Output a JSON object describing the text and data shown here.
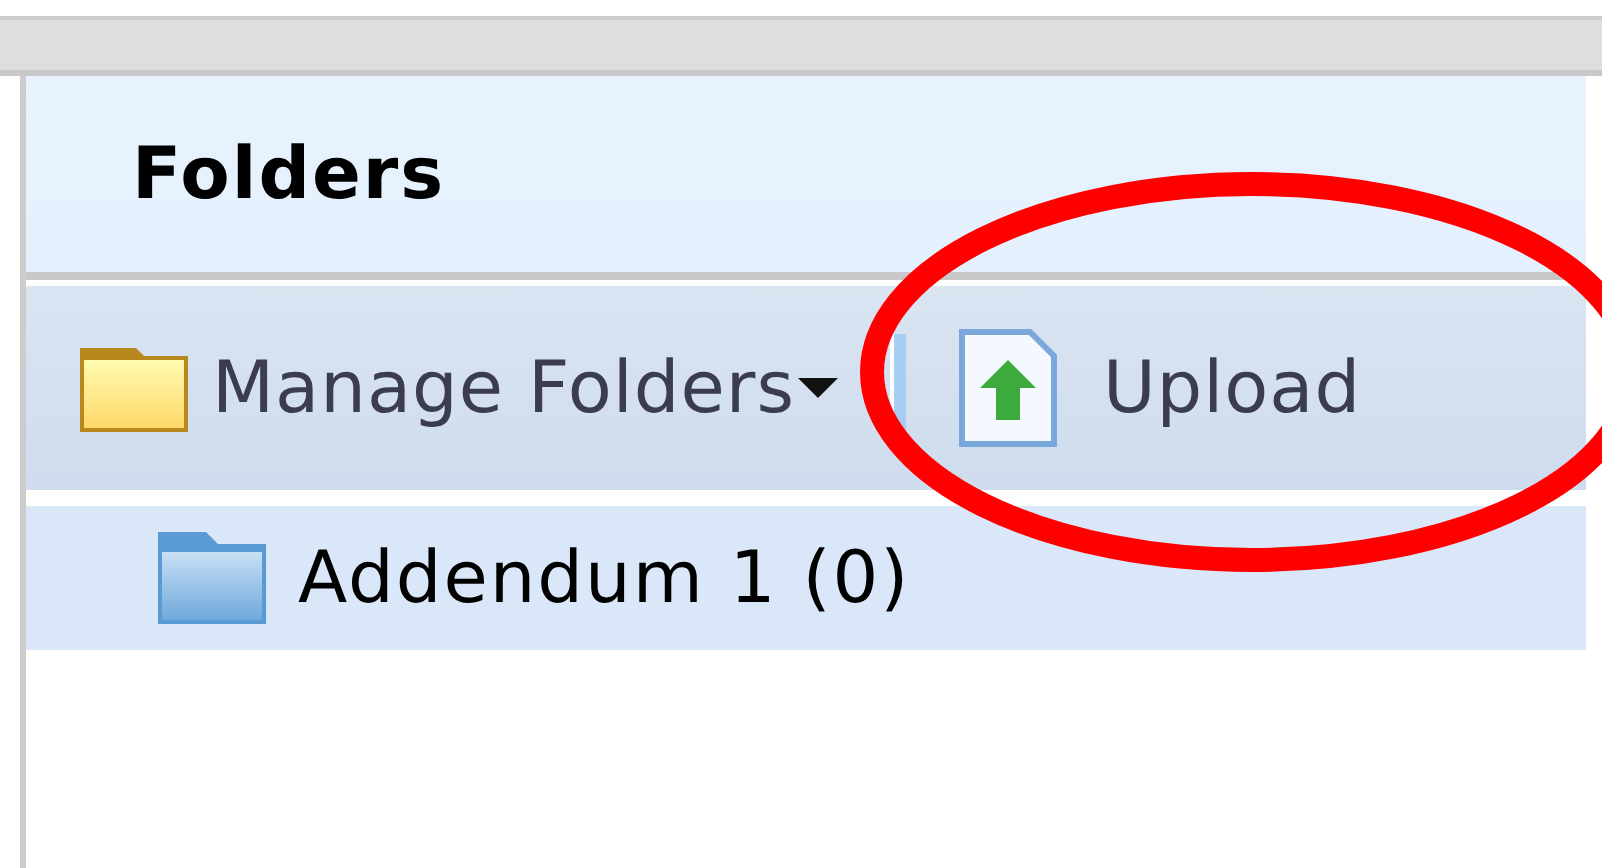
{
  "panel": {
    "title": "Folders"
  },
  "toolbar": {
    "items": [
      {
        "kind": "menu",
        "label": "Manage Folders"
      },
      {
        "kind": "separator"
      },
      {
        "kind": "upload",
        "label": "Upload"
      }
    ]
  },
  "folders": [
    {
      "label": "Addendum 1 (0)",
      "selected": true
    }
  ],
  "annotation": {
    "kind": "ellipse",
    "color": "#ff0000"
  }
}
